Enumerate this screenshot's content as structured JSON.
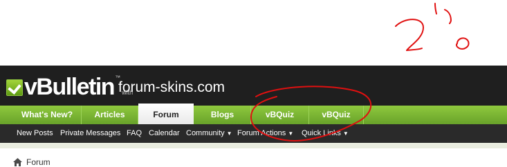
{
  "header": {
    "logo_text": "vBulletin",
    "logo_tm": "™",
    "logo_with": "with",
    "site_name": "forum-skins.com"
  },
  "nav": {
    "tabs": [
      {
        "label": "What's New?"
      },
      {
        "label": "Articles"
      },
      {
        "label": "Forum",
        "active": true
      },
      {
        "label": "Blogs"
      },
      {
        "label": "vBQuiz"
      },
      {
        "label": "vBQuiz"
      }
    ]
  },
  "subnav": {
    "items": [
      {
        "label": "New Posts"
      },
      {
        "label": "Private Messages"
      },
      {
        "label": "FAQ"
      },
      {
        "label": "Calendar"
      },
      {
        "label": "Community",
        "dropdown": true
      },
      {
        "label": "Forum Actions",
        "dropdown": true
      },
      {
        "label": "Quick Links",
        "dropdown": true
      }
    ]
  },
  "breadcrumb": {
    "current": "Forum",
    "icon": "home-icon"
  },
  "annotation": {
    "handwritten_text": "2.0",
    "color": "#e01010"
  },
  "colors": {
    "header_bg": "#1f1f1f",
    "nav_green": "#78b232",
    "subnav_bg": "#2a2a2a"
  }
}
